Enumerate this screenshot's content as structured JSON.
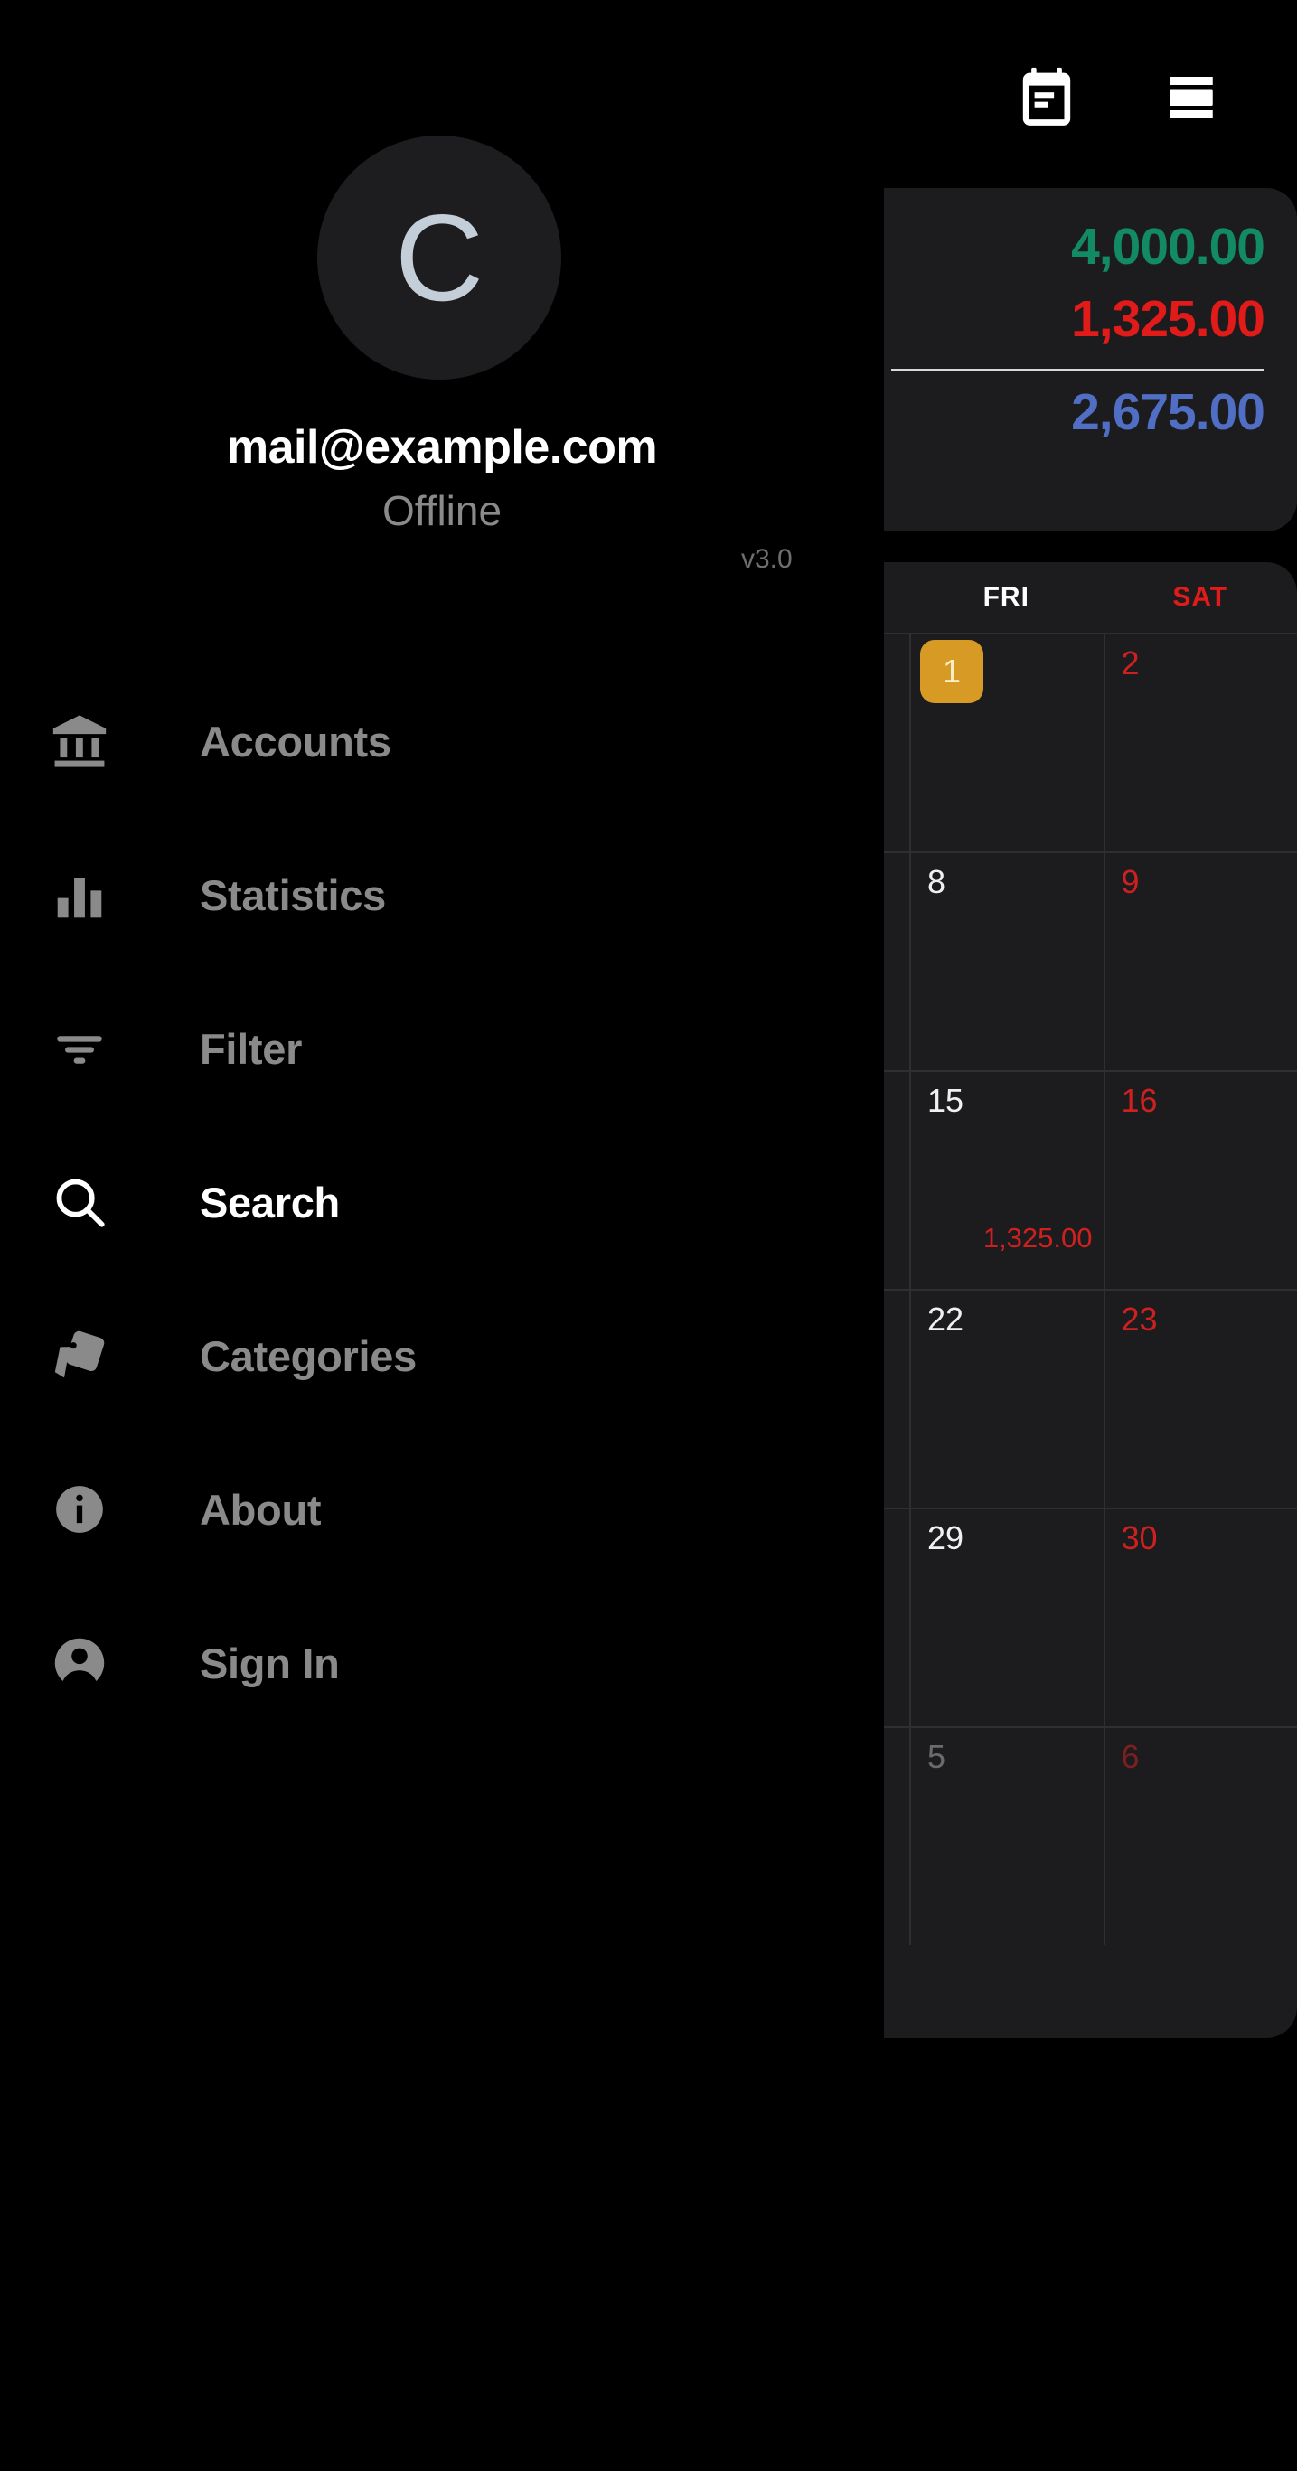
{
  "topbar": {
    "gear_icon": "gear-icon",
    "calendar_icon": "calendar-icon",
    "menu_icon": "menu-icon"
  },
  "drawer": {
    "avatar_letter": "C",
    "email": "mail@example.com",
    "status": "Offline",
    "version": "v3.0",
    "nav_items": [
      {
        "label": "Accounts",
        "icon": "bank-icon",
        "active": false
      },
      {
        "label": "Statistics",
        "icon": "bar-chart-icon",
        "active": false
      },
      {
        "label": "Filter",
        "icon": "filter-icon",
        "active": false
      },
      {
        "label": "Search",
        "icon": "search-icon",
        "active": true
      },
      {
        "label": "Categories",
        "icon": "tags-icon",
        "active": false
      },
      {
        "label": "About",
        "icon": "info-circle-icon",
        "active": false
      },
      {
        "label": "Sign In",
        "icon": "account-icon",
        "active": false
      }
    ]
  },
  "balance": {
    "income": "4,000.00",
    "expense": "1,325.00",
    "total": "2,675.00",
    "income_color": "#128a63",
    "expense_color": "#e01b19",
    "total_color": "#4f6ec4"
  },
  "calendar": {
    "headers": [
      {
        "label": "FRI",
        "weekend": false
      },
      {
        "label": "SAT",
        "weekend": true
      }
    ],
    "today_color": "#d79a24",
    "rows": [
      {
        "cells": [
          {
            "day": "1",
            "kind": "today",
            "amount": ""
          },
          {
            "day": "2",
            "kind": "weekend",
            "amount": ""
          }
        ]
      },
      {
        "cells": [
          {
            "day": "8",
            "kind": "weekday",
            "amount": ""
          },
          {
            "day": "9",
            "kind": "weekend",
            "amount": ""
          }
        ]
      },
      {
        "cells": [
          {
            "day": "15",
            "kind": "weekday",
            "amount": "1,325.00"
          },
          {
            "day": "16",
            "kind": "weekend",
            "amount": ""
          }
        ]
      },
      {
        "cells": [
          {
            "day": "22",
            "kind": "weekday",
            "amount": ""
          },
          {
            "day": "23",
            "kind": "weekend",
            "amount": ""
          }
        ]
      },
      {
        "cells": [
          {
            "day": "29",
            "kind": "weekday",
            "amount": ""
          },
          {
            "day": "30",
            "kind": "weekend",
            "amount": ""
          }
        ]
      },
      {
        "cells": [
          {
            "day": "5",
            "kind": "muted-weekday",
            "amount": ""
          },
          {
            "day": "6",
            "kind": "muted-weekend",
            "amount": ""
          }
        ]
      }
    ]
  }
}
